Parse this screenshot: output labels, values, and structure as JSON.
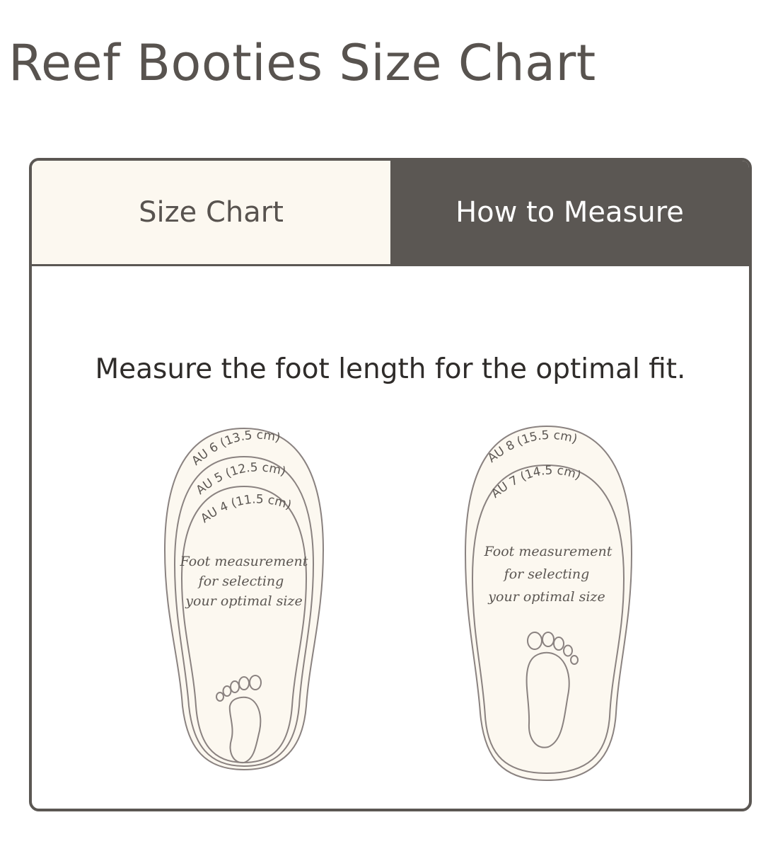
{
  "page": {
    "title": "Reef Booties Size Chart"
  },
  "tabs": [
    {
      "label": "Size Chart",
      "active": false
    },
    {
      "label": "How to Measure",
      "active": true
    }
  ],
  "content": {
    "instruction": "Measure the foot length for the optimal fit.",
    "illustrations": [
      {
        "sizes": [
          "AU 6 (13.5 cm)",
          "AU 5 (12.5 cm)",
          "AU 4 (11.5 cm)"
        ],
        "caption_lines": [
          "Foot measurement",
          "for selecting",
          "your optimal size"
        ]
      },
      {
        "sizes": [
          "AU 8 (15.5 cm)",
          "AU 7 (14.5 cm)"
        ],
        "caption_lines": [
          "Foot measurement",
          "for selecting",
          "your optimal size"
        ]
      }
    ]
  },
  "colors": {
    "primary_dark": "#5b5753",
    "tab_inactive_bg": "#fcf8f0",
    "sole_fill": "#fcf8f0",
    "outline": "#8a8280"
  }
}
